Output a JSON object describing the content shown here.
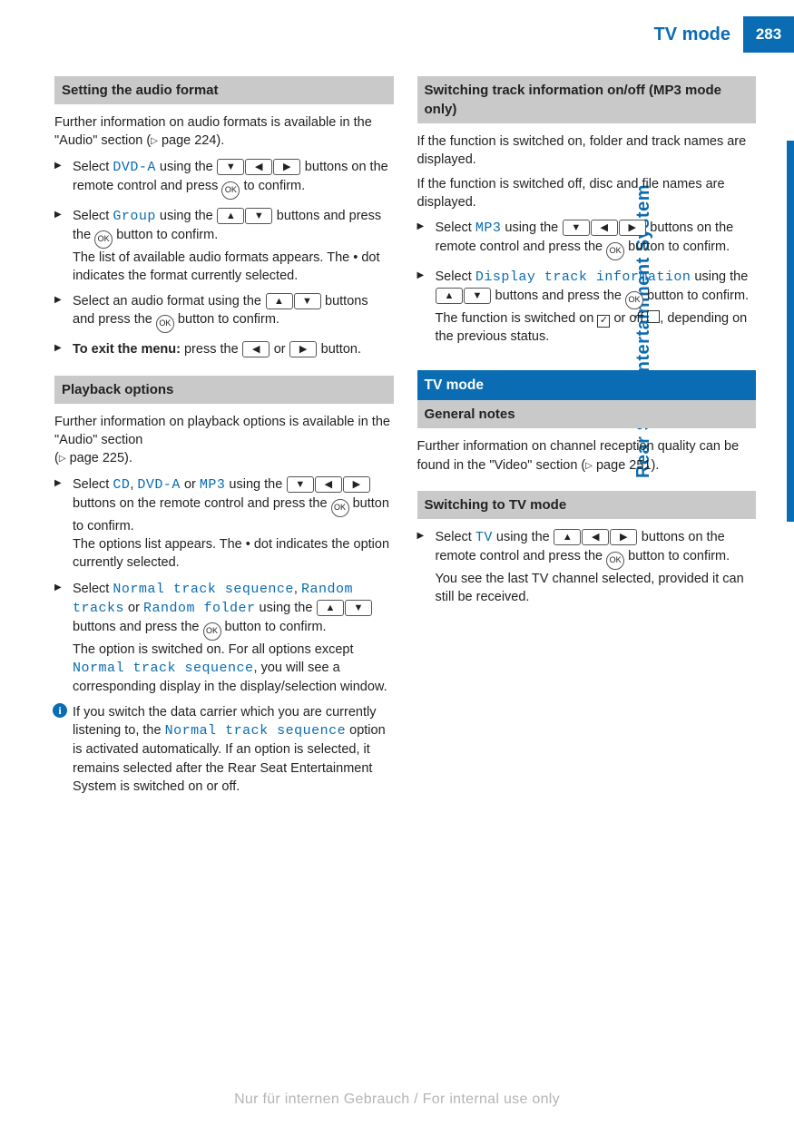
{
  "header": {
    "title": "TV mode",
    "page_number": "283"
  },
  "side_tab": "Rear Seat Entertainment System",
  "watermark": "Nur für internen Gebrauch / For internal use only",
  "icons": {
    "up": "▲",
    "down": "▼",
    "left": "◀",
    "right": "▶",
    "ok": "OK",
    "checked": "✓",
    "unchecked": ""
  },
  "left": {
    "sec1": {
      "heading": "Setting the audio format",
      "intro_a": "Further information on audio formats is available in the \"Audio\" section (",
      "intro_b": " page 224).",
      "step1_a": "Select ",
      "step1_mono": "DVD-A",
      "step1_b": " using the ",
      "step1_c": " buttons on the remote control and press ",
      "step1_d": " to confirm.",
      "step2_a": "Select ",
      "step2_mono": "Group",
      "step2_b": " using the ",
      "step2_c": " buttons and press the ",
      "step2_d": " button to confirm.",
      "step2_e": "The list of available audio formats appears. The  ",
      "step2_f": "  dot indicates the format currently selected.",
      "step3_a": "Select an audio format using the ",
      "step3_b": " buttons and press the ",
      "step3_c": " button to confirm.",
      "step4_a": "To exit the menu:",
      "step4_b": " press the ",
      "step4_c": " or ",
      "step4_d": " button."
    },
    "sec2": {
      "heading": "Playback options",
      "intro_a": "Further information on playback options is available in the \"Audio\" section",
      "intro_b": "(",
      "intro_c": " page 225).",
      "step1_a": "Select ",
      "m_cd": "CD",
      "comma": ", ",
      "m_dvda": "DVD-A",
      "or": " or ",
      "m_mp3": "MP3",
      "step1_b": " using the ",
      "step1_c": " buttons on the remote control and press the ",
      "step1_d": " button to confirm.",
      "step1_e": "The options list appears. The  ",
      "step1_f": "  dot indicates the option currently selected.",
      "step2_a": "Select ",
      "m_normal": "Normal track sequence",
      "m_random_tracks": "Random tracks",
      "m_random_folder": "Random folder",
      "step2_b": " using the ",
      "step2_c": " buttons and press the ",
      "step2_d": " button to confirm.",
      "step2_e": "The option is switched on. For all options except ",
      "step2_f": ", you will see a corresponding display in the display/selection window.",
      "info_a": "If you switch the data carrier which you are currently listening to, the ",
      "info_b": " option is activated automatically. If an option is selected, it remains selected after the Rear Seat Entertainment System is switched on or off."
    }
  },
  "right": {
    "sec1": {
      "heading": "Switching track information on/off (MP3 mode only)",
      "p1": "If the function is switched on, folder and track names are displayed.",
      "p2": "If the function is switched off, disc and file names are displayed.",
      "step1_a": "Select ",
      "m_mp3": "MP3",
      "step1_b": " using the ",
      "step1_c": " buttons on the remote control and press the ",
      "step1_d": " button to confirm.",
      "step2_a": "Select ",
      "m_dti": "Display track information",
      "step2_b": " using the ",
      "step2_c": " buttons and press the ",
      "step2_d": " button to confirm.",
      "step2_e": "The function is switched on ",
      "step2_f": " or off ",
      "step2_g": ", depending on the previous status."
    },
    "sec2": {
      "blue_heading": "TV mode",
      "grey_heading": "General notes",
      "p_a": "Further information on channel reception quality can be found in the \"Video\" section (",
      "p_b": " page 251)."
    },
    "sec3": {
      "heading": "Switching to TV mode",
      "step1_a": "Select ",
      "m_tv": "TV",
      "step1_b": " using the ",
      "step1_c": " buttons on the remote control and press the ",
      "step1_d": " button to confirm.",
      "step1_e": "You see the last TV channel selected, provided it can still be received."
    }
  }
}
